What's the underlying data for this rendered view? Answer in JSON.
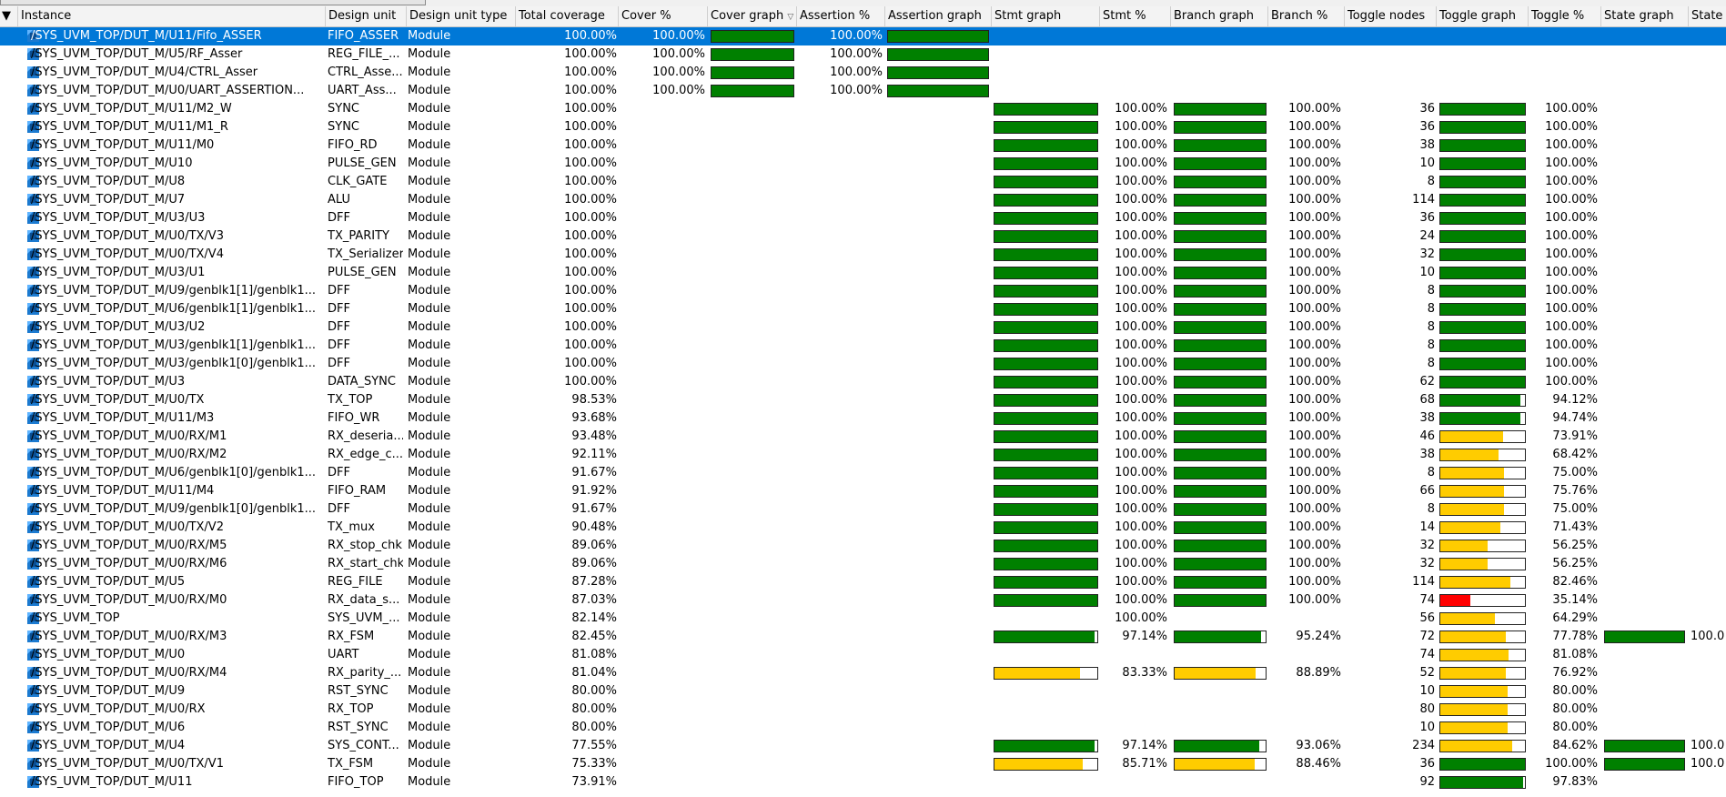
{
  "columns": [
    "Instance",
    "Design unit",
    "Design unit type",
    "Total coverage",
    "Cover %",
    "Cover graph",
    "Assertion %",
    "Assertion graph",
    "Stmt graph",
    "Stmt %",
    "Branch graph",
    "Branch %",
    "Toggle nodes",
    "Toggle graph",
    "Toggle %",
    "State graph",
    "State"
  ],
  "sort_indicator": "▽",
  "colors": {
    "good": "#008000",
    "warn": "#ffcc00",
    "bad": "#ff0000",
    "selection": "#0078d7"
  },
  "rows": [
    {
      "instance": "/SYS_UVM_TOP/DUT_M/U11/Fifo_ASSER",
      "unit": "FIFO_ASSER",
      "type": "Module",
      "total": "100.00%",
      "cover": "100.00%",
      "cover_v": 100,
      "assert": "100.00%",
      "assert_v": 100,
      "selected": true
    },
    {
      "instance": "/SYS_UVM_TOP/DUT_M/U5/RF_Asser",
      "unit": "REG_FILE_...",
      "type": "Module",
      "total": "100.00%",
      "cover": "100.00%",
      "cover_v": 100,
      "assert": "100.00%",
      "assert_v": 100
    },
    {
      "instance": "/SYS_UVM_TOP/DUT_M/U4/CTRL_Asser",
      "unit": "CTRL_Asse...",
      "type": "Module",
      "total": "100.00%",
      "cover": "100.00%",
      "cover_v": 100,
      "assert": "100.00%",
      "assert_v": 100
    },
    {
      "instance": "/SYS_UVM_TOP/DUT_M/U0/UART_ASSERTION...",
      "unit": "UART_Ass...",
      "type": "Module",
      "total": "100.00%",
      "cover": "100.00%",
      "cover_v": 100,
      "assert": "100.00%",
      "assert_v": 100
    },
    {
      "instance": "/SYS_UVM_TOP/DUT_M/U11/M2_W",
      "unit": "SYNC",
      "type": "Module",
      "total": "100.00%",
      "stmt": "100.00%",
      "stmt_v": 100,
      "branch": "100.00%",
      "branch_v": 100,
      "nodes": "36",
      "toggle": "100.00%",
      "toggle_v": 100
    },
    {
      "instance": "/SYS_UVM_TOP/DUT_M/U11/M1_R",
      "unit": "SYNC",
      "type": "Module",
      "total": "100.00%",
      "stmt": "100.00%",
      "stmt_v": 100,
      "branch": "100.00%",
      "branch_v": 100,
      "nodes": "36",
      "toggle": "100.00%",
      "toggle_v": 100
    },
    {
      "instance": "/SYS_UVM_TOP/DUT_M/U11/M0",
      "unit": "FIFO_RD",
      "type": "Module",
      "total": "100.00%",
      "stmt": "100.00%",
      "stmt_v": 100,
      "branch": "100.00%",
      "branch_v": 100,
      "nodes": "38",
      "toggle": "100.00%",
      "toggle_v": 100
    },
    {
      "instance": "/SYS_UVM_TOP/DUT_M/U10",
      "unit": "PULSE_GEN",
      "type": "Module",
      "total": "100.00%",
      "stmt": "100.00%",
      "stmt_v": 100,
      "branch": "100.00%",
      "branch_v": 100,
      "nodes": "10",
      "toggle": "100.00%",
      "toggle_v": 100
    },
    {
      "instance": "/SYS_UVM_TOP/DUT_M/U8",
      "unit": "CLK_GATE",
      "type": "Module",
      "total": "100.00%",
      "stmt": "100.00%",
      "stmt_v": 100,
      "branch": "100.00%",
      "branch_v": 100,
      "nodes": "8",
      "toggle": "100.00%",
      "toggle_v": 100
    },
    {
      "instance": "/SYS_UVM_TOP/DUT_M/U7",
      "unit": "ALU",
      "type": "Module",
      "total": "100.00%",
      "stmt": "100.00%",
      "stmt_v": 100,
      "branch": "100.00%",
      "branch_v": 100,
      "nodes": "114",
      "toggle": "100.00%",
      "toggle_v": 100
    },
    {
      "instance": "/SYS_UVM_TOP/DUT_M/U3/U3",
      "unit": "DFF",
      "type": "Module",
      "total": "100.00%",
      "stmt": "100.00%",
      "stmt_v": 100,
      "branch": "100.00%",
      "branch_v": 100,
      "nodes": "36",
      "toggle": "100.00%",
      "toggle_v": 100
    },
    {
      "instance": "/SYS_UVM_TOP/DUT_M/U0/TX/V3",
      "unit": "TX_PARITY",
      "type": "Module",
      "total": "100.00%",
      "stmt": "100.00%",
      "stmt_v": 100,
      "branch": "100.00%",
      "branch_v": 100,
      "nodes": "24",
      "toggle": "100.00%",
      "toggle_v": 100
    },
    {
      "instance": "/SYS_UVM_TOP/DUT_M/U0/TX/V4",
      "unit": "TX_Serializer",
      "type": "Module",
      "total": "100.00%",
      "stmt": "100.00%",
      "stmt_v": 100,
      "branch": "100.00%",
      "branch_v": 100,
      "nodes": "32",
      "toggle": "100.00%",
      "toggle_v": 100
    },
    {
      "instance": "/SYS_UVM_TOP/DUT_M/U3/U1",
      "unit": "PULSE_GEN",
      "type": "Module",
      "total": "100.00%",
      "stmt": "100.00%",
      "stmt_v": 100,
      "branch": "100.00%",
      "branch_v": 100,
      "nodes": "10",
      "toggle": "100.00%",
      "toggle_v": 100
    },
    {
      "instance": "/SYS_UVM_TOP/DUT_M/U9/genblk1[1]/genblk1...",
      "unit": "DFF",
      "type": "Module",
      "total": "100.00%",
      "stmt": "100.00%",
      "stmt_v": 100,
      "branch": "100.00%",
      "branch_v": 100,
      "nodes": "8",
      "toggle": "100.00%",
      "toggle_v": 100
    },
    {
      "instance": "/SYS_UVM_TOP/DUT_M/U6/genblk1[1]/genblk1...",
      "unit": "DFF",
      "type": "Module",
      "total": "100.00%",
      "stmt": "100.00%",
      "stmt_v": 100,
      "branch": "100.00%",
      "branch_v": 100,
      "nodes": "8",
      "toggle": "100.00%",
      "toggle_v": 100
    },
    {
      "instance": "/SYS_UVM_TOP/DUT_M/U3/U2",
      "unit": "DFF",
      "type": "Module",
      "total": "100.00%",
      "stmt": "100.00%",
      "stmt_v": 100,
      "branch": "100.00%",
      "branch_v": 100,
      "nodes": "8",
      "toggle": "100.00%",
      "toggle_v": 100
    },
    {
      "instance": "/SYS_UVM_TOP/DUT_M/U3/genblk1[1]/genblk1...",
      "unit": "DFF",
      "type": "Module",
      "total": "100.00%",
      "stmt": "100.00%",
      "stmt_v": 100,
      "branch": "100.00%",
      "branch_v": 100,
      "nodes": "8",
      "toggle": "100.00%",
      "toggle_v": 100
    },
    {
      "instance": "/SYS_UVM_TOP/DUT_M/U3/genblk1[0]/genblk1...",
      "unit": "DFF",
      "type": "Module",
      "total": "100.00%",
      "stmt": "100.00%",
      "stmt_v": 100,
      "branch": "100.00%",
      "branch_v": 100,
      "nodes": "8",
      "toggle": "100.00%",
      "toggle_v": 100
    },
    {
      "instance": "/SYS_UVM_TOP/DUT_M/U3",
      "unit": "DATA_SYNC",
      "type": "Module",
      "total": "100.00%",
      "stmt": "100.00%",
      "stmt_v": 100,
      "branch": "100.00%",
      "branch_v": 100,
      "nodes": "62",
      "toggle": "100.00%",
      "toggle_v": 100
    },
    {
      "instance": "/SYS_UVM_TOP/DUT_M/U0/TX",
      "unit": "TX_TOP",
      "type": "Module",
      "total": "98.53%",
      "stmt": "100.00%",
      "stmt_v": 100,
      "branch": "100.00%",
      "branch_v": 100,
      "nodes": "68",
      "toggle": "94.12%",
      "toggle_v": 94.12
    },
    {
      "instance": "/SYS_UVM_TOP/DUT_M/U11/M3",
      "unit": "FIFO_WR",
      "type": "Module",
      "total": "93.68%",
      "stmt": "100.00%",
      "stmt_v": 100,
      "branch": "100.00%",
      "branch_v": 100,
      "nodes": "38",
      "toggle": "94.74%",
      "toggle_v": 94.74
    },
    {
      "instance": "/SYS_UVM_TOP/DUT_M/U0/RX/M1",
      "unit": "RX_deseria...",
      "type": "Module",
      "total": "93.48%",
      "stmt": "100.00%",
      "stmt_v": 100,
      "branch": "100.00%",
      "branch_v": 100,
      "nodes": "46",
      "toggle": "73.91%",
      "toggle_v": 73.91
    },
    {
      "instance": "/SYS_UVM_TOP/DUT_M/U0/RX/M2",
      "unit": "RX_edge_c...",
      "type": "Module",
      "total": "92.11%",
      "stmt": "100.00%",
      "stmt_v": 100,
      "branch": "100.00%",
      "branch_v": 100,
      "nodes": "38",
      "toggle": "68.42%",
      "toggle_v": 68.42
    },
    {
      "instance": "/SYS_UVM_TOP/DUT_M/U6/genblk1[0]/genblk1...",
      "unit": "DFF",
      "type": "Module",
      "total": "91.67%",
      "stmt": "100.00%",
      "stmt_v": 100,
      "branch": "100.00%",
      "branch_v": 100,
      "nodes": "8",
      "toggle": "75.00%",
      "toggle_v": 75
    },
    {
      "instance": "/SYS_UVM_TOP/DUT_M/U11/M4",
      "unit": "FIFO_RAM",
      "type": "Module",
      "total": "91.92%",
      "stmt": "100.00%",
      "stmt_v": 100,
      "branch": "100.00%",
      "branch_v": 100,
      "nodes": "66",
      "toggle": "75.76%",
      "toggle_v": 75.76
    },
    {
      "instance": "/SYS_UVM_TOP/DUT_M/U9/genblk1[0]/genblk1...",
      "unit": "DFF",
      "type": "Module",
      "total": "91.67%",
      "stmt": "100.00%",
      "stmt_v": 100,
      "branch": "100.00%",
      "branch_v": 100,
      "nodes": "8",
      "toggle": "75.00%",
      "toggle_v": 75
    },
    {
      "instance": "/SYS_UVM_TOP/DUT_M/U0/TX/V2",
      "unit": "TX_mux",
      "type": "Module",
      "total": "90.48%",
      "stmt": "100.00%",
      "stmt_v": 100,
      "branch": "100.00%",
      "branch_v": 100,
      "nodes": "14",
      "toggle": "71.43%",
      "toggle_v": 71.43
    },
    {
      "instance": "/SYS_UVM_TOP/DUT_M/U0/RX/M5",
      "unit": "RX_stop_chk",
      "type": "Module",
      "total": "89.06%",
      "stmt": "100.00%",
      "stmt_v": 100,
      "branch": "100.00%",
      "branch_v": 100,
      "nodes": "32",
      "toggle": "56.25%",
      "toggle_v": 56.25
    },
    {
      "instance": "/SYS_UVM_TOP/DUT_M/U0/RX/M6",
      "unit": "RX_start_chk",
      "type": "Module",
      "total": "89.06%",
      "stmt": "100.00%",
      "stmt_v": 100,
      "branch": "100.00%",
      "branch_v": 100,
      "nodes": "32",
      "toggle": "56.25%",
      "toggle_v": 56.25
    },
    {
      "instance": "/SYS_UVM_TOP/DUT_M/U5",
      "unit": "REG_FILE",
      "type": "Module",
      "total": "87.28%",
      "stmt": "100.00%",
      "stmt_v": 100,
      "branch": "100.00%",
      "branch_v": 100,
      "nodes": "114",
      "toggle": "82.46%",
      "toggle_v": 82.46
    },
    {
      "instance": "/SYS_UVM_TOP/DUT_M/U0/RX/M0",
      "unit": "RX_data_s...",
      "type": "Module",
      "total": "87.03%",
      "stmt": "100.00%",
      "stmt_v": 100,
      "branch": "100.00%",
      "branch_v": 100,
      "nodes": "74",
      "toggle": "35.14%",
      "toggle_v": 35.14
    },
    {
      "instance": "/SYS_UVM_TOP",
      "unit": "SYS_UVM_...",
      "type": "Module",
      "total": "82.14%",
      "stmt": "100.00%",
      "nodes": "56",
      "toggle": "64.29%",
      "toggle_v": 64.29
    },
    {
      "instance": "/SYS_UVM_TOP/DUT_M/U0/RX/M3",
      "unit": "RX_FSM",
      "type": "Module",
      "total": "82.45%",
      "stmt": "97.14%",
      "stmt_v": 97.14,
      "branch": "95.24%",
      "branch_v": 95.24,
      "nodes": "72",
      "toggle": "77.78%",
      "toggle_v": 77.78,
      "state": "100.0",
      "state_v": 100
    },
    {
      "instance": "/SYS_UVM_TOP/DUT_M/U0",
      "unit": "UART",
      "type": "Module",
      "total": "81.08%",
      "nodes": "74",
      "toggle": "81.08%",
      "toggle_v": 81.08
    },
    {
      "instance": "/SYS_UVM_TOP/DUT_M/U0/RX/M4",
      "unit": "RX_parity_...",
      "type": "Module",
      "total": "81.04%",
      "stmt": "83.33%",
      "stmt_v": 83.33,
      "branch": "88.89%",
      "branch_v": 88.89,
      "nodes": "52",
      "toggle": "76.92%",
      "toggle_v": 76.92
    },
    {
      "instance": "/SYS_UVM_TOP/DUT_M/U9",
      "unit": "RST_SYNC",
      "type": "Module",
      "total": "80.00%",
      "nodes": "10",
      "toggle": "80.00%",
      "toggle_v": 80
    },
    {
      "instance": "/SYS_UVM_TOP/DUT_M/U0/RX",
      "unit": "RX_TOP",
      "type": "Module",
      "total": "80.00%",
      "nodes": "80",
      "toggle": "80.00%",
      "toggle_v": 80
    },
    {
      "instance": "/SYS_UVM_TOP/DUT_M/U6",
      "unit": "RST_SYNC",
      "type": "Module",
      "total": "80.00%",
      "nodes": "10",
      "toggle": "80.00%",
      "toggle_v": 80
    },
    {
      "instance": "/SYS_UVM_TOP/DUT_M/U4",
      "unit": "SYS_CONT...",
      "type": "Module",
      "total": "77.55%",
      "stmt": "97.14%",
      "stmt_v": 97.14,
      "branch": "93.06%",
      "branch_v": 93.06,
      "nodes": "234",
      "toggle": "84.62%",
      "toggle_v": 84.62,
      "state": "100.0",
      "state_v": 100
    },
    {
      "instance": "/SYS_UVM_TOP/DUT_M/U0/TX/V1",
      "unit": "TX_FSM",
      "type": "Module",
      "total": "75.33%",
      "stmt": "85.71%",
      "stmt_v": 85.71,
      "branch": "88.46%",
      "branch_v": 88.46,
      "nodes": "36",
      "toggle": "100.00%",
      "toggle_v": 100,
      "state": "100.0",
      "state_v": 100
    },
    {
      "instance": "/SYS_UVM_TOP/DUT_M/U11",
      "unit": "FIFO_TOP",
      "type": "Module",
      "total": "73.91%",
      "nodes": "92",
      "toggle": "97.83%",
      "toggle_v": 97.83
    }
  ]
}
